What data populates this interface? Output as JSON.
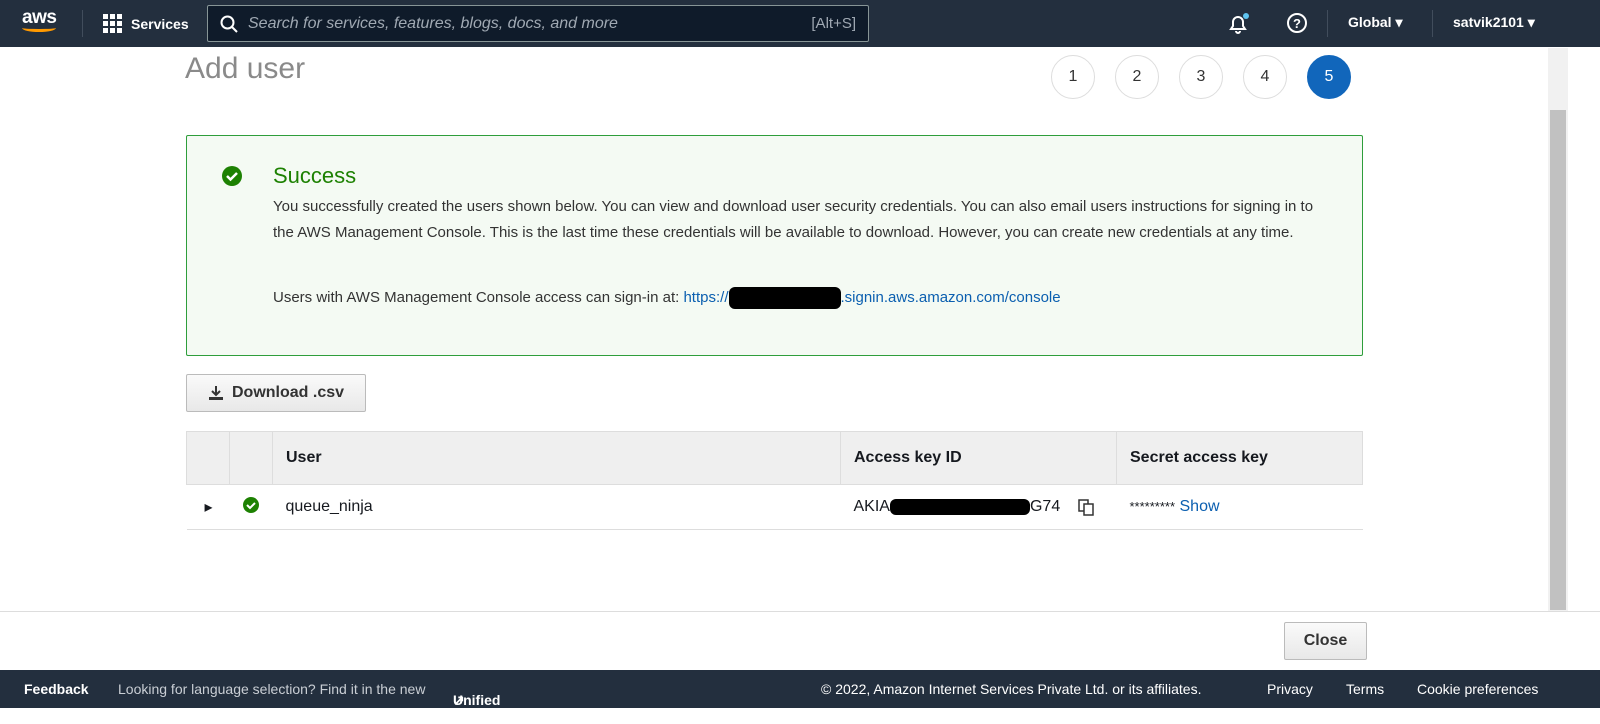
{
  "topnav": {
    "logo": "aws",
    "services": "Services",
    "search_placeholder": "Search for services, features, blogs, docs, and more",
    "search_shortcut": "[Alt+S]",
    "region": "Global",
    "user": "satvik2101"
  },
  "page": {
    "title": "Add user",
    "steps": [
      "1",
      "2",
      "3",
      "4",
      "5"
    ],
    "active_step": 5
  },
  "alert": {
    "title": "Success",
    "body": "You successfully created the users shown below. You can view and download user security credentials. You can also email users instructions for signing in to the AWS Management Console. This is the last time these credentials will be available to download. However, you can create new credentials at any time.",
    "signin_label": "Users with AWS Management Console access can sign-in at:",
    "signin_prefix": "https://",
    "signin_suffix": ".signin.aws.amazon.com/console"
  },
  "download_button": "Download .csv",
  "table": {
    "headers": [
      "User",
      "Access key ID",
      "Secret access key"
    ],
    "rows": [
      {
        "user": "queue_ninja",
        "key_prefix": "AKIA",
        "key_suffix": "G74",
        "secret": "*********",
        "show": "Show"
      }
    ]
  },
  "close_button": "Close",
  "footer": {
    "feedback": "Feedback",
    "lang_text": "Looking for language selection? Find it in the new",
    "unified": "Unified Settings",
    "copyright": "© 2022, Amazon Internet Services Private Ltd. or its affiliates.",
    "privacy": "Privacy",
    "terms": "Terms",
    "cookies": "Cookie preferences"
  },
  "colors": {
    "nav": "#232f3e",
    "success": "#1d8102",
    "link": "#0b5fb0",
    "active_step": "#1166bb"
  }
}
